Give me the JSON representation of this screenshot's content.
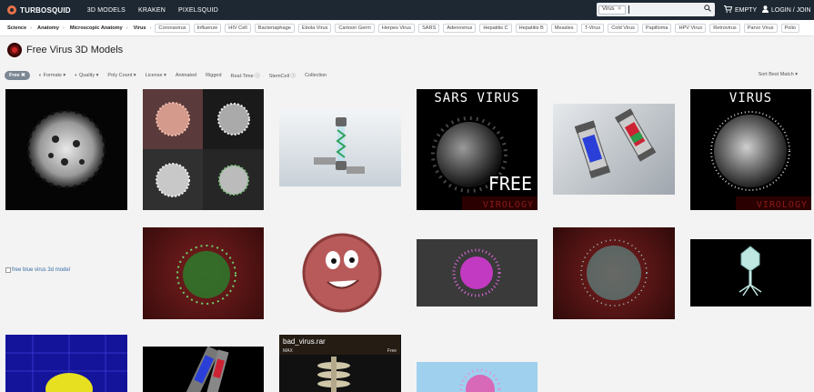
{
  "topnav": {
    "brand": "TURBOSQUID",
    "links": [
      "3D MODELS",
      "KRAKEN",
      "PIXELSQUID"
    ],
    "search_chip": "Virus",
    "search_value": "",
    "cart_label": "EMPTY",
    "login_label": "LOGIN / JOIN"
  },
  "breadcrumb": {
    "items": [
      "Science",
      "Anatomy",
      "Microscopic Anatomy",
      "Virus"
    ],
    "tags": [
      "Coronavirus",
      "Influenze",
      "HIV Cell",
      "Bacteriaphage",
      "Ebola Virus",
      "Cartoon Germ",
      "Herpes Virus",
      "SARS",
      "Adenovirus",
      "Hepatitis C",
      "Hepatitis B",
      "Measles",
      "T-Virus",
      "Cold Virus",
      "Papilloma",
      "HPV Virus",
      "Retrovirus",
      "Parvo Virus",
      "Polio"
    ]
  },
  "page": {
    "title": "Free Virus 3D Models"
  },
  "filters": {
    "active_chip": "Free ✖",
    "items": [
      "Formats ▾",
      "Quality ▾",
      "Poly Count ▾",
      "License ▾",
      "Animated",
      "Rigged",
      "Real-Time ⓘ",
      "StemCell ⓘ",
      "Collection"
    ],
    "sort_label": "Sort Best Match ▾"
  },
  "products": {
    "broken_alt": "free blue virus 3d model",
    "sars_title": "SARS VIRUS",
    "sars_free": "FREE",
    "sars_brand": "VIROLOGY",
    "virus_title": "VIRUS",
    "virus_brand": "VIROLOGY",
    "bad_virus_title": "bad_virus.rar",
    "bad_virus_format": "MAX",
    "bad_virus_price": "Free"
  },
  "colors": {
    "nav_bg": "#1d2833",
    "accent": "#e8734a",
    "page_bg": "#f3f3f3",
    "chip_bg": "#7b8793"
  }
}
